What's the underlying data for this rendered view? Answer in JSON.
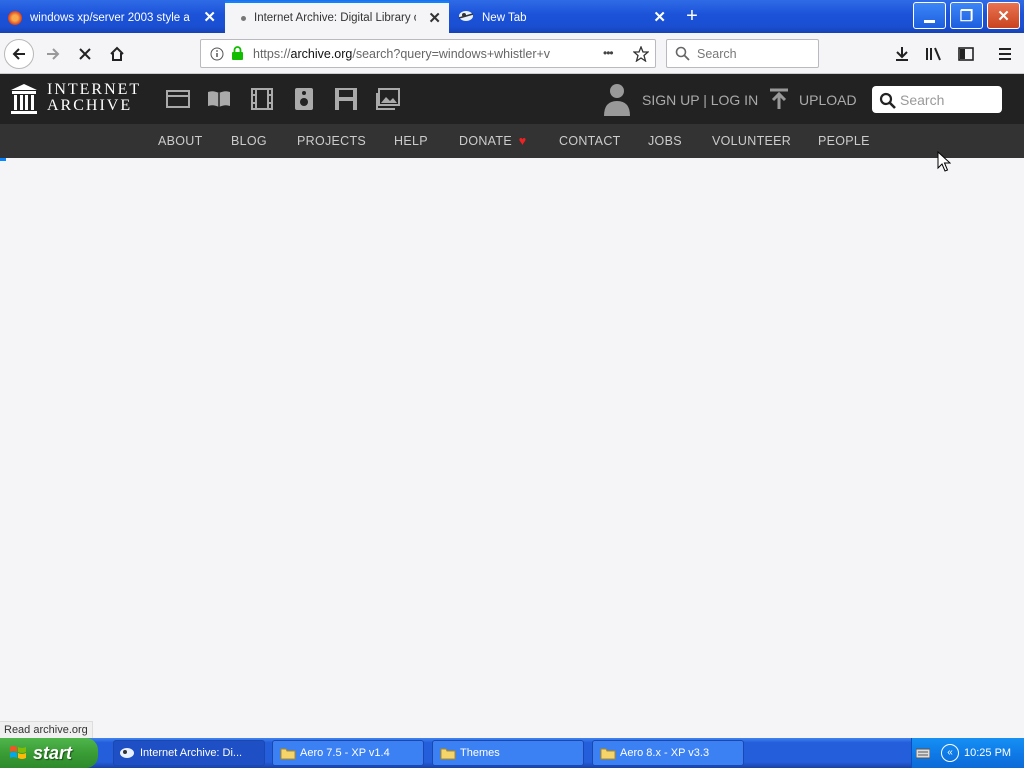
{
  "browser": {
    "tabs": [
      {
        "title": "windows xp/server 2003 style arch",
        "active": false
      },
      {
        "title": "Internet Archive: Digital Library of",
        "active": true
      },
      {
        "title": "New Tab",
        "active": false
      }
    ],
    "new_tab_symbol": "+",
    "window_controls": {
      "minimize": "_",
      "maximize": "❐",
      "close": "✕"
    },
    "url": {
      "prefix": "https://",
      "domain": "archive.org",
      "rest": "/search?query=windows+whistler+v"
    },
    "search_placeholder": "Search",
    "overflow_symbol": "•••"
  },
  "archive": {
    "logo": {
      "line1": "INTERNET",
      "line2": "ARCHIVE"
    },
    "media_icons": [
      "web-icon",
      "texts-icon",
      "video-icon",
      "audio-icon",
      "software-icon",
      "images-icon"
    ],
    "signup_label": "SIGN UP | LOG IN",
    "upload_label": "UPLOAD",
    "search_placeholder": "Search",
    "nav": [
      "ABOUT",
      "BLOG",
      "PROJECTS",
      "HELP",
      "DONATE",
      "CONTACT",
      "JOBS",
      "VOLUNTEER",
      "PEOPLE"
    ],
    "donate_heart": "♥"
  },
  "status_text": "Read archive.org",
  "taskbar": {
    "start_label": "start",
    "buttons": [
      "Internet Archive: Di...",
      "Aero 7.5 - XP v1.4",
      "Themes",
      "Aero 8.x - XP v3.3"
    ],
    "clock": "10:25 PM"
  },
  "colors": {
    "xp_blue": "#245edb",
    "ia_dark": "#222222",
    "ia_nav": "#333333",
    "accent": "#0a84ff"
  }
}
